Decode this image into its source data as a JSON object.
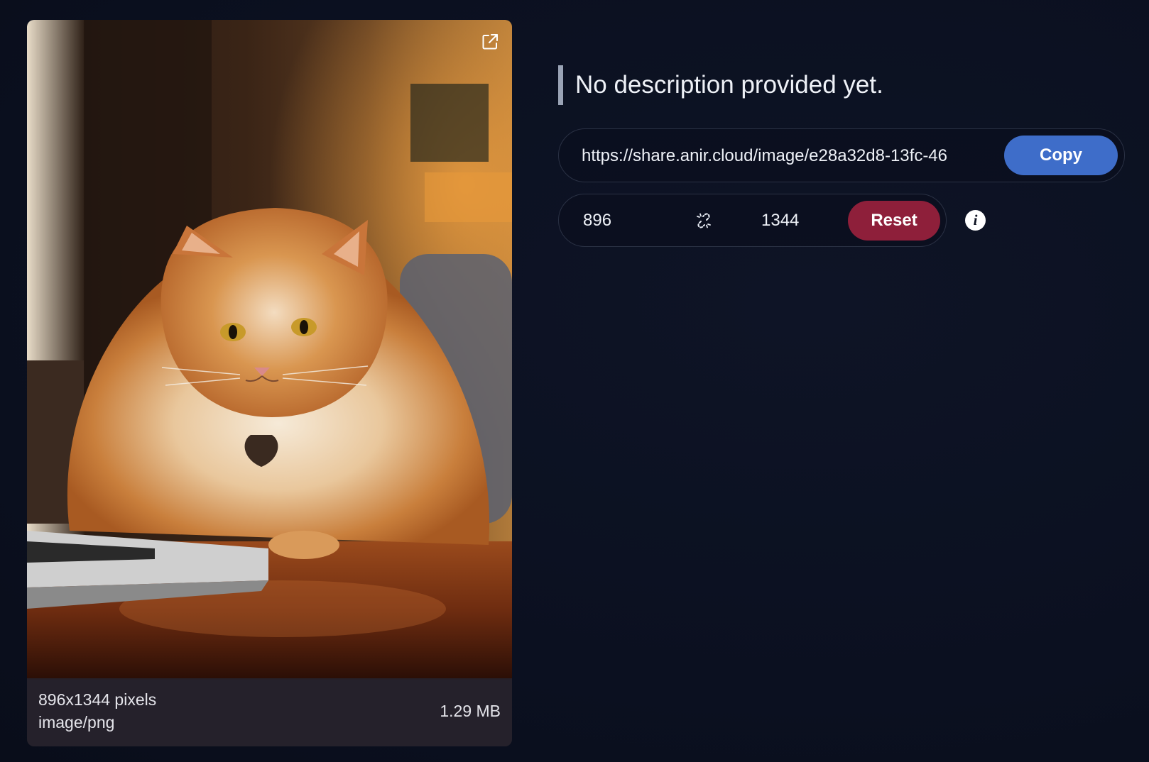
{
  "image": {
    "dimensions_label": "896x1344 pixels",
    "mime_label": "image/png",
    "size_label": "1.29 MB",
    "open_icon": "external-link-icon"
  },
  "description": "No description provided yet.",
  "share": {
    "url": "https://share.anir.cloud/image/e28a32d8-13fc-46",
    "copy_label": "Copy"
  },
  "resize": {
    "width": "896",
    "height": "1344",
    "link_icon": "unlink-icon",
    "reset_label": "Reset",
    "info_icon": "info-icon",
    "info_glyph": "i"
  },
  "colors": {
    "copy": "#3e6dc9",
    "reset": "#8e1f3a",
    "background": "#0b1020"
  }
}
